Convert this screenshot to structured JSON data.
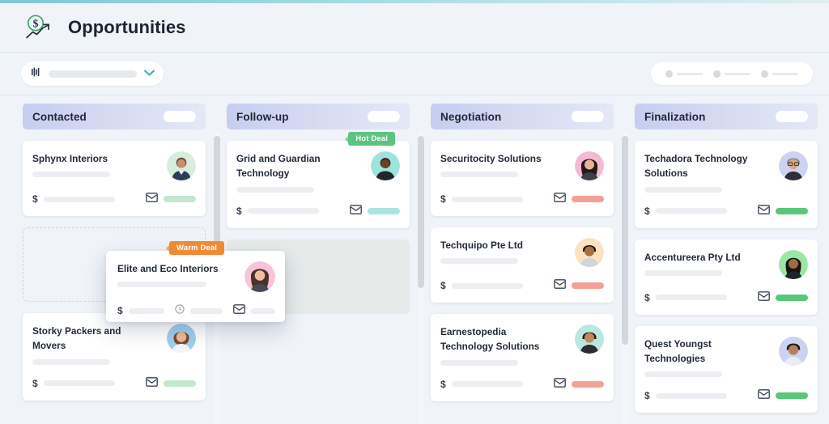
{
  "theme": {
    "page_bg": "#f0f3f7",
    "accent_top": "#7fc7d4",
    "column_header_gradient_from": "#c6cdef",
    "column_header_gradient_to": "#e4e8f6",
    "hot_deal_color": "#5bc47f",
    "warm_deal_color": "#f08b33",
    "status_green": "#57c877",
    "status_green_soft": "#c4e8cd",
    "status_teal": "#a9e5e2",
    "status_salmon": "#f4a097",
    "brand_green": "#3fa86a",
    "chevron_teal": "#3db3b7"
  },
  "header": {
    "title": "Opportunities",
    "logo_icon": "dollar-growth-chart-icon"
  },
  "toolbar": {
    "filter": {
      "icon": "filter-icon",
      "value": "",
      "placeholder": "",
      "chevron_icon": "chevron-down-icon"
    },
    "stepper": {
      "steps": 3,
      "icon": "progress-steps-placeholder"
    }
  },
  "board": {
    "columns": [
      {
        "id": "contacted",
        "title": "Contacted",
        "toggle_icon": "toggle-pill",
        "scrollbar": {
          "thumb_top": 0,
          "thumb_height": 100
        },
        "cards": [
          {
            "name": "Sphynx Interiors",
            "badge": null,
            "avatar": "avatar-man-green",
            "amount_placeholder": true,
            "mail_icon": "envelope-icon",
            "status_color": "#c4e8cd",
            "has_clock": false
          }
        ],
        "dropzone": {
          "type": "dashed-empty"
        },
        "cards_after": [
          {
            "name": "Storky Packers and Movers",
            "badge": null,
            "avatar": "avatar-woman-blue",
            "amount_placeholder": true,
            "mail_icon": "envelope-icon",
            "status_color": "#c4e8cd",
            "has_clock": false
          }
        ]
      },
      {
        "id": "follow-up",
        "title": "Follow-up",
        "toggle_icon": "toggle-pill",
        "scrollbar": {
          "thumb_top": 0,
          "thumb_height": 130
        },
        "cards": [
          {
            "name": "Grid and Guardian Technology",
            "badge": {
              "label": "Hot Deal",
              "color": "#5bc47f"
            },
            "avatar": "avatar-man-teal",
            "amount_placeholder": true,
            "mail_icon": "envelope-icon",
            "status_color": "#a9e5e2",
            "has_clock": false
          }
        ],
        "dropzone": {
          "type": "filled-target"
        },
        "cards_after": []
      },
      {
        "id": "negotiation",
        "title": "Negotiation",
        "toggle_icon": "toggle-pill",
        "scrollbar": {
          "thumb_top": 0,
          "thumb_height": 170
        },
        "cards": [
          {
            "name": "Securitocity Solutions",
            "badge": null,
            "avatar": "avatar-woman-pink",
            "amount_placeholder": true,
            "mail_icon": "envelope-icon",
            "status_color": "#f4a097",
            "has_clock": false
          },
          {
            "name": "Techquipo Pte Ltd",
            "badge": null,
            "avatar": "avatar-man-cream",
            "amount_placeholder": true,
            "mail_icon": "envelope-icon",
            "status_color": "#f4a097",
            "has_clock": false
          },
          {
            "name": "Earnestopedia Technology Solutions",
            "badge": null,
            "avatar": "avatar-man-mint",
            "amount_placeholder": true,
            "mail_icon": "envelope-icon",
            "status_color": "#f4a097",
            "has_clock": false
          }
        ],
        "dropzone": null,
        "cards_after": []
      },
      {
        "id": "finalization",
        "title": "Finalization",
        "toggle_icon": "toggle-pill",
        "scrollbar": null,
        "cards": [
          {
            "name": "Techadora Technology Solutions",
            "badge": null,
            "avatar": "avatar-man-lavender",
            "amount_placeholder": true,
            "mail_icon": "envelope-icon",
            "status_color": "#57c877",
            "has_clock": false
          },
          {
            "name": "Accentureera Pty Ltd",
            "badge": null,
            "avatar": "avatar-woman-green",
            "amount_placeholder": true,
            "mail_icon": "envelope-icon",
            "status_color": "#57c877",
            "has_clock": false
          },
          {
            "name": "Quest Youngst Technologies",
            "badge": null,
            "avatar": "avatar-man-periwinkle",
            "amount_placeholder": true,
            "mail_icon": "envelope-icon",
            "status_color": "#57c877",
            "has_clock": false
          }
        ],
        "dropzone": null,
        "cards_after": []
      }
    ]
  },
  "drag_card": {
    "name": "Elite and Eco Interiors",
    "badge": {
      "label": "Warm Deal",
      "color": "#f08b33"
    },
    "avatar": "avatar-woman-pink-long",
    "amount_placeholder": true,
    "clock_icon": "clock-icon",
    "mail_icon": "envelope-icon",
    "is_dragging": true
  }
}
